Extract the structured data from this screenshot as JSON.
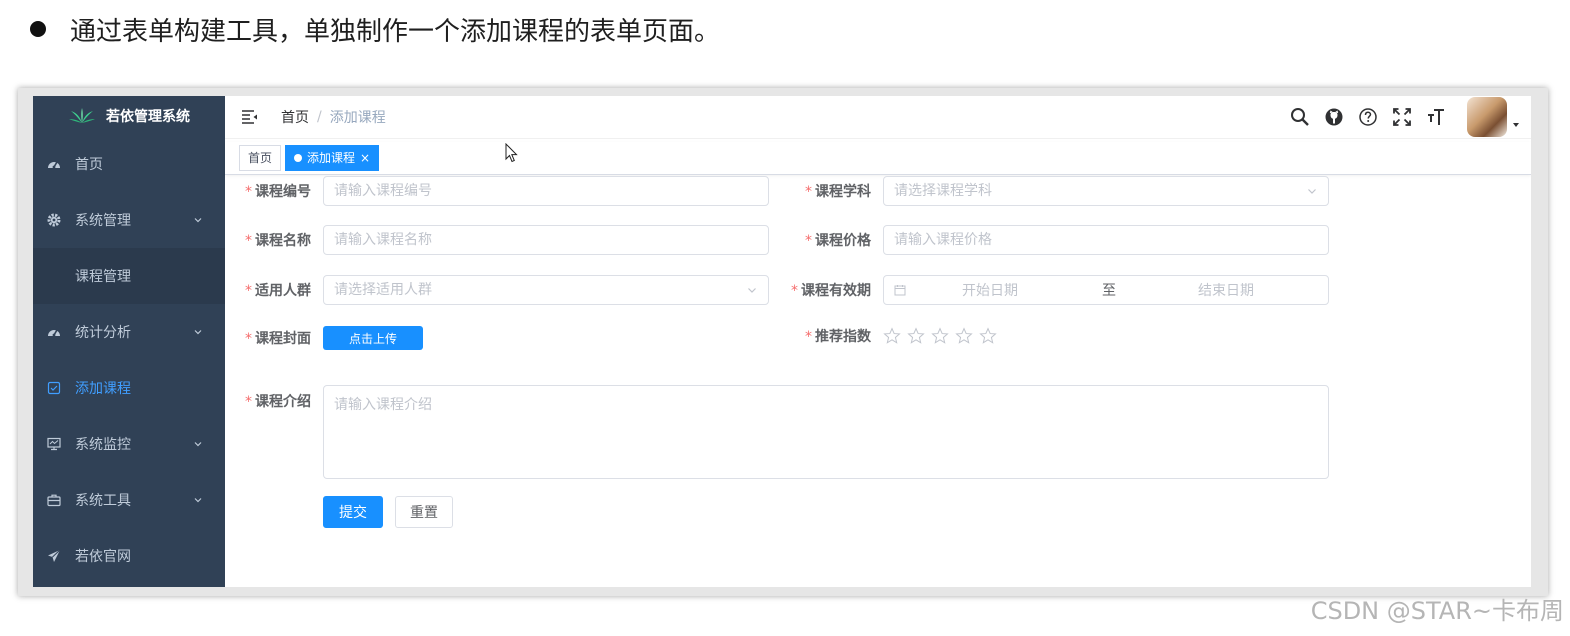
{
  "slide": {
    "bullet_text": "通过表单构建工具，单独制作一个添加课程的表单页面。",
    "watermark": "CSDN @STAR~卡布周"
  },
  "app": {
    "title": "若依管理系统",
    "accent_color": "#1890ff",
    "sidebar_bg": "#304156"
  },
  "sidebar": {
    "items": [
      {
        "label": "首页",
        "icon": "dashboard-icon"
      },
      {
        "label": "系统管理",
        "icon": "gear-icon",
        "expandable": true
      },
      {
        "label": "课程管理",
        "submenu": true
      },
      {
        "label": "统计分析",
        "icon": "dashboard-icon",
        "expandable": true
      },
      {
        "label": "添加课程",
        "icon": "form-icon",
        "active": true
      },
      {
        "label": "系统监控",
        "icon": "monitor-icon",
        "expandable": true
      },
      {
        "label": "系统工具",
        "icon": "toolbox-icon",
        "expandable": true
      },
      {
        "label": "若依官网",
        "icon": "send-icon"
      }
    ]
  },
  "header": {
    "breadcrumb_home": "首页",
    "breadcrumb_sep": "/",
    "breadcrumb_current": "添加课程",
    "icons": [
      "search-icon",
      "github-icon",
      "help-icon",
      "fullscreen-icon",
      "font-size-icon"
    ]
  },
  "tags": {
    "home": "首页",
    "current": "添加课程",
    "close": "×"
  },
  "form": {
    "code": {
      "label": "课程编号",
      "placeholder": "请输入课程编号"
    },
    "subject": {
      "label": "课程学科",
      "placeholder": "请选择课程学科"
    },
    "name": {
      "label": "课程名称",
      "placeholder": "请输入课程名称"
    },
    "price": {
      "label": "课程价格",
      "placeholder": "请输入课程价格"
    },
    "audience": {
      "label": "适用人群",
      "placeholder": "请选择适用人群"
    },
    "validity": {
      "label": "课程有效期",
      "start_placeholder": "开始日期",
      "separator": "至",
      "end_placeholder": "结束日期"
    },
    "cover": {
      "label": "课程封面",
      "button": "点击上传"
    },
    "rating": {
      "label": "推荐指数",
      "max": 5,
      "value": 0
    },
    "intro": {
      "label": "课程介绍",
      "placeholder": "请输入课程介绍"
    },
    "submit": "提交",
    "reset": "重置",
    "required_mark": "*"
  }
}
